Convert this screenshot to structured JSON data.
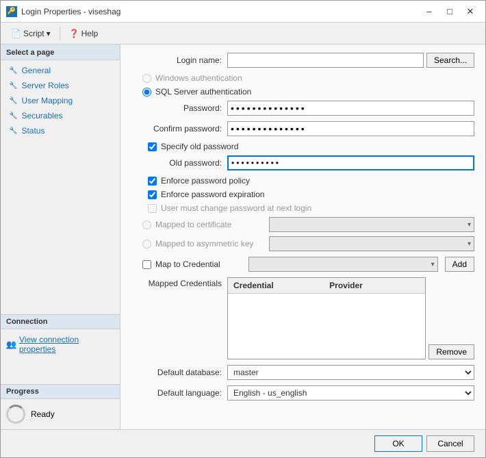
{
  "window": {
    "title": "Login Properties - viseshag",
    "icon": "🔑"
  },
  "toolbar": {
    "script_label": "Script",
    "help_label": "Help"
  },
  "sidebar": {
    "select_page_label": "Select a page",
    "items": [
      {
        "label": "General",
        "icon": "🔧"
      },
      {
        "label": "Server Roles",
        "icon": "🔧"
      },
      {
        "label": "User Mapping",
        "icon": "🔧"
      },
      {
        "label": "Securables",
        "icon": "🔧"
      },
      {
        "label": "Status",
        "icon": "🔧"
      }
    ],
    "connection_label": "Connection",
    "view_connection_label": "View connection properties",
    "progress_label": "Progress",
    "ready_label": "Ready"
  },
  "form": {
    "login_name_label": "Login name:",
    "login_name_value": "",
    "search_button": "Search...",
    "windows_auth_label": "Windows authentication",
    "sql_auth_label": "SQL Server authentication",
    "password_label": "Password:",
    "password_value": "••••••••••••••",
    "confirm_password_label": "Confirm password:",
    "confirm_password_value": "••••••••••••••",
    "specify_old_password_label": "Specify old password",
    "old_password_label": "Old password:",
    "old_password_value": "••••••••••",
    "enforce_policy_label": "Enforce password policy",
    "enforce_expiration_label": "Enforce password expiration",
    "user_must_change_label": "User must change password at next login",
    "mapped_to_cert_label": "Mapped to certificate",
    "mapped_to_asym_label": "Mapped to asymmetric key",
    "map_to_credential_label": "Map to Credential",
    "add_button": "Add",
    "mapped_credentials_label": "Mapped Credentials",
    "credential_col": "Credential",
    "provider_col": "Provider",
    "remove_button": "Remove",
    "default_database_label": "Default database:",
    "default_database_value": "master",
    "default_language_label": "Default language:",
    "default_language_value": "English - us_english",
    "ok_button": "OK",
    "cancel_button": "Cancel"
  }
}
